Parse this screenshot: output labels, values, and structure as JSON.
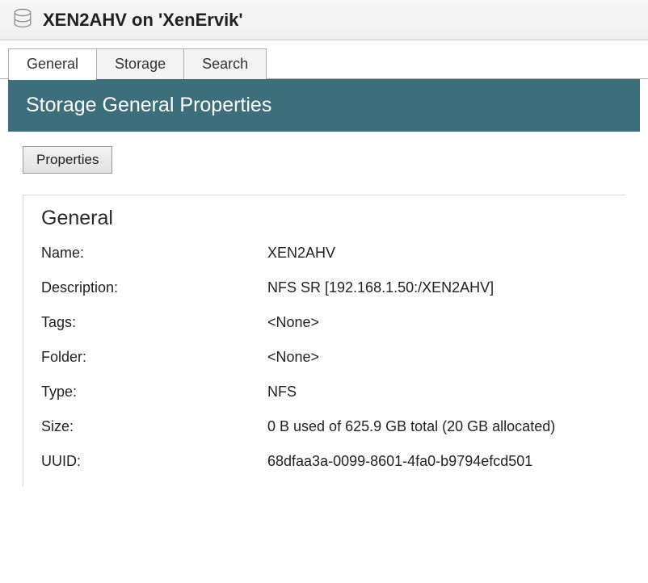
{
  "titleBar": {
    "title": "XEN2AHV on 'XenErvik'"
  },
  "tabs": [
    {
      "label": "General",
      "active": true
    },
    {
      "label": "Storage",
      "active": false
    },
    {
      "label": "Search",
      "active": false
    }
  ],
  "hero": "Storage General Properties",
  "buttons": {
    "properties": "Properties"
  },
  "section": {
    "title": "General",
    "rows": [
      {
        "label": "Name:",
        "value": "XEN2AHV"
      },
      {
        "label": "Description:",
        "value": "NFS SR [192.168.1.50:/XEN2AHV]"
      },
      {
        "label": "Tags:",
        "value": "<None>"
      },
      {
        "label": "Folder:",
        "value": "<None>"
      },
      {
        "label": "Type:",
        "value": "NFS"
      },
      {
        "label": "Size:",
        "value": "0 B used of 625.9 GB total (20 GB allocated)"
      },
      {
        "label": "UUID:",
        "value": "68dfaa3a-0099-8601-4fa0-b9794efcd501"
      }
    ]
  }
}
